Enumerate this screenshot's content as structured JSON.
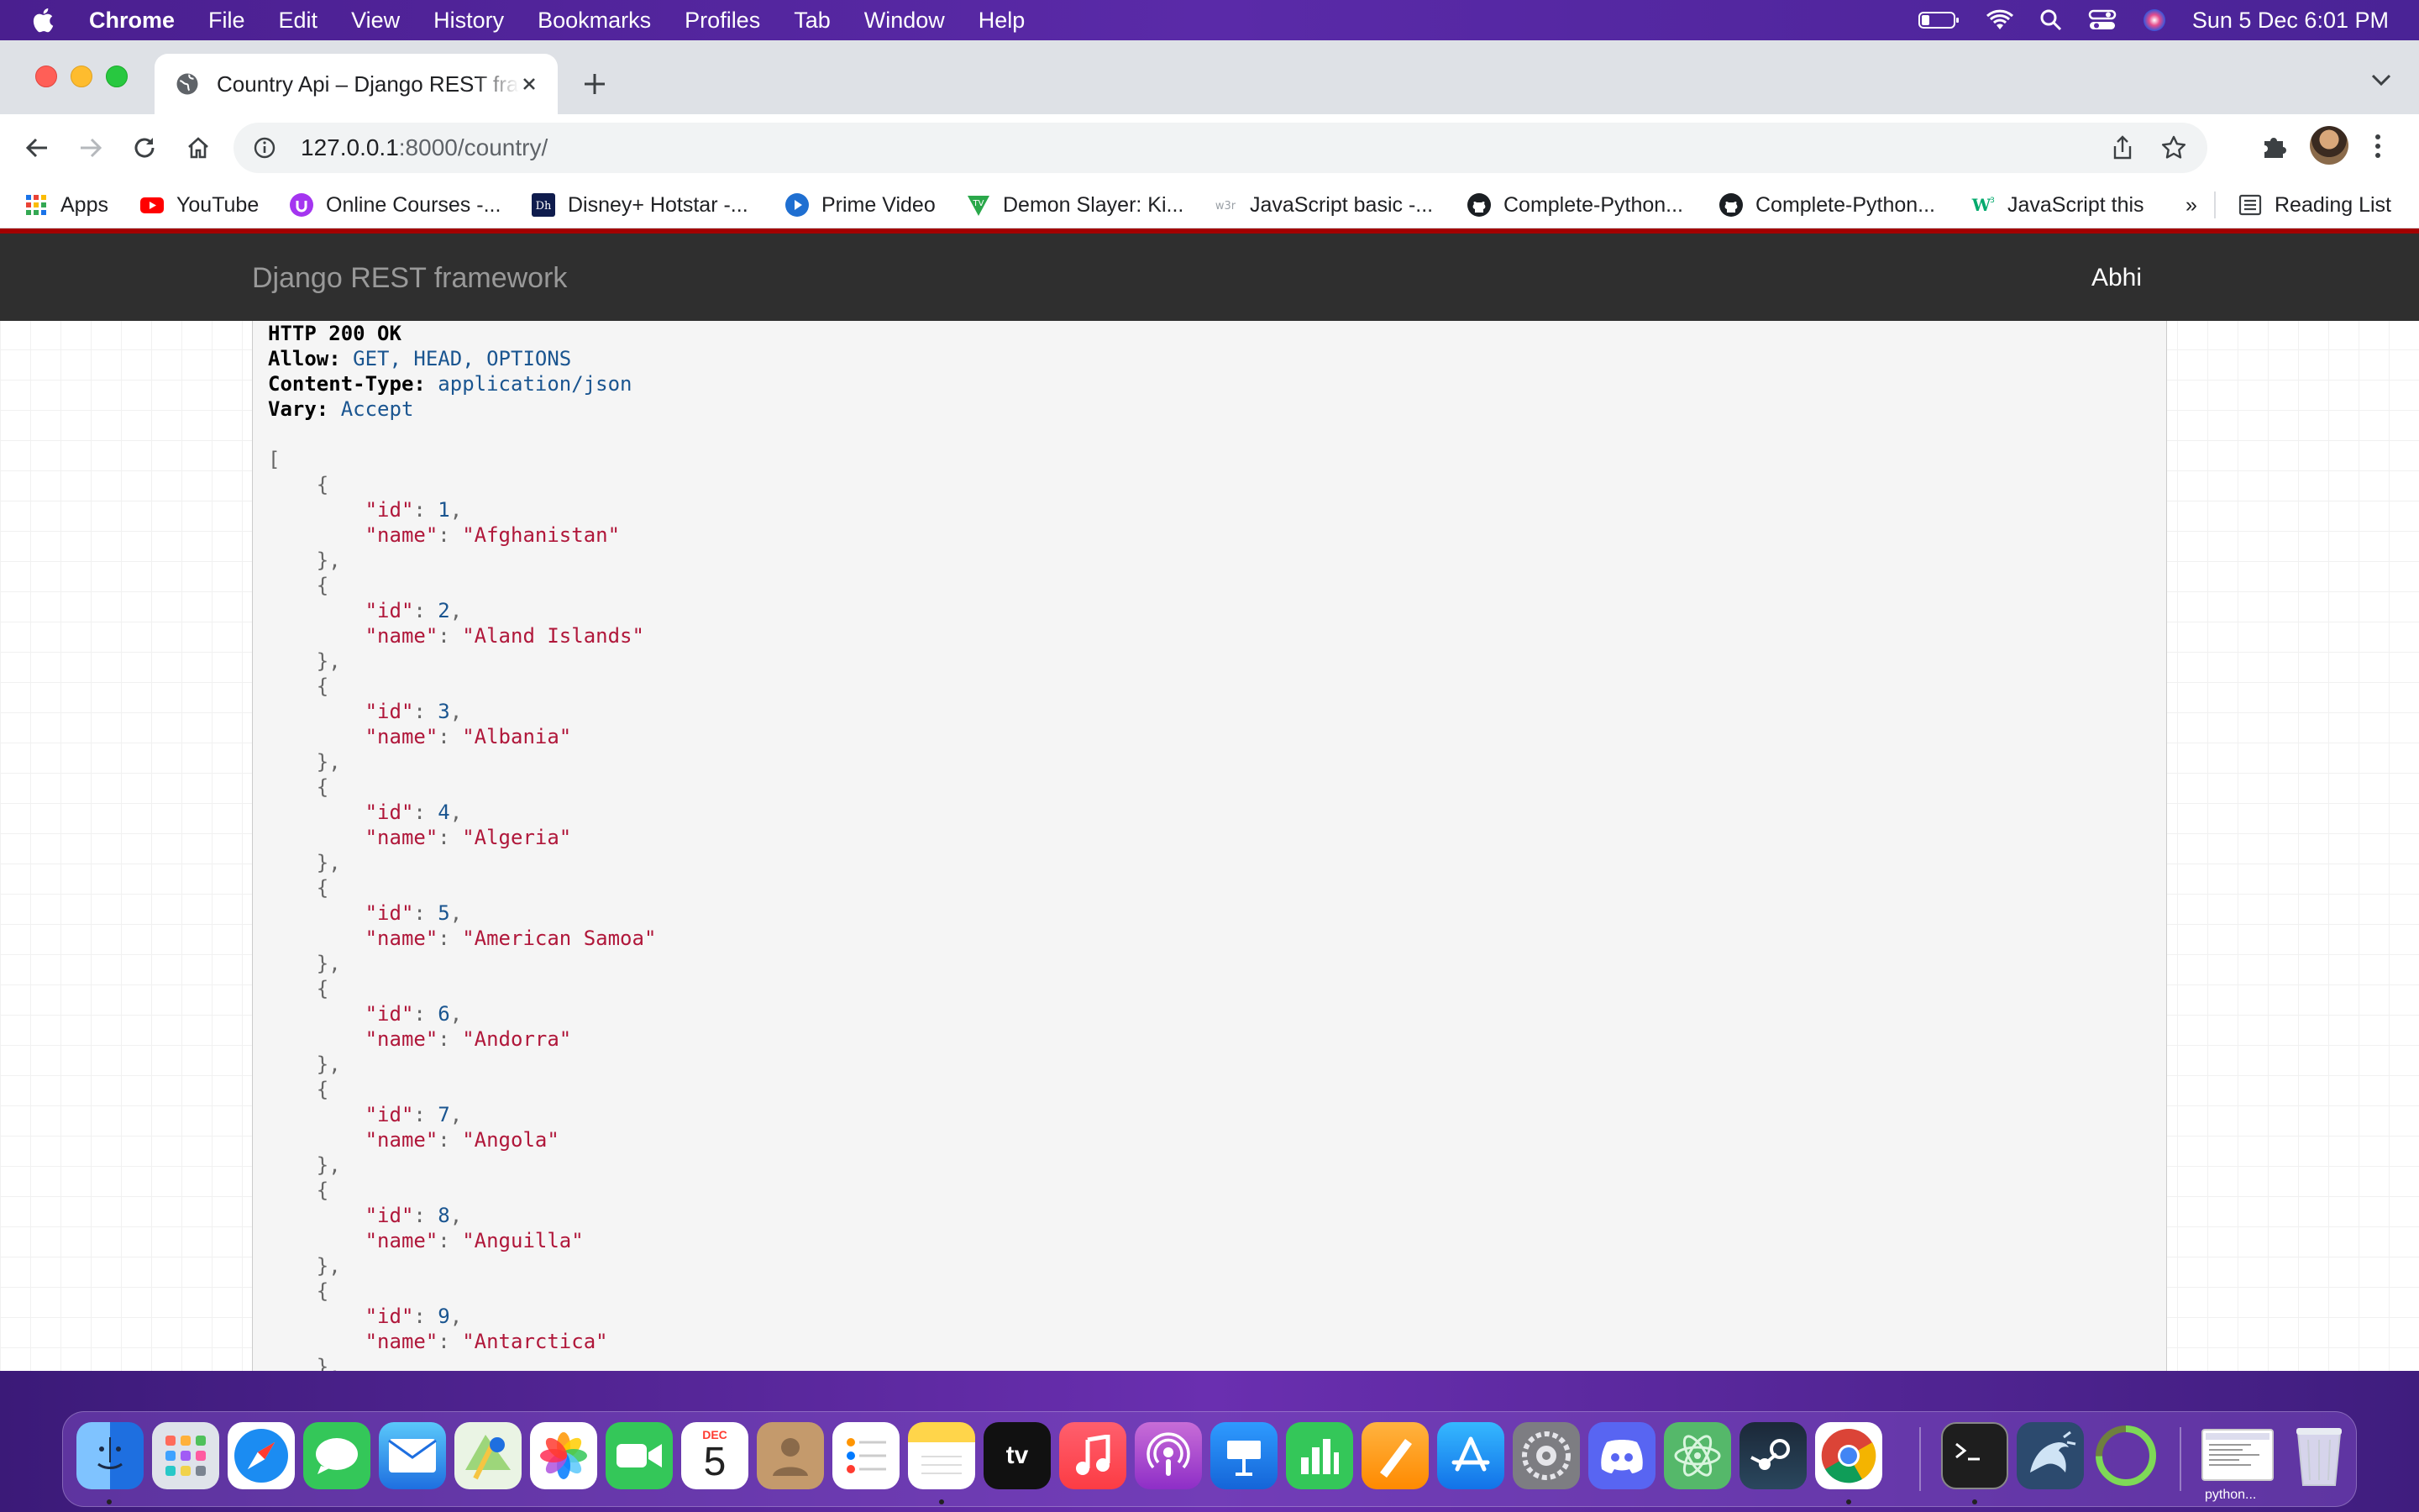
{
  "menubar": {
    "app_name": "Chrome",
    "menus": [
      "File",
      "Edit",
      "View",
      "History",
      "Bookmarks",
      "Profiles",
      "Tab",
      "Window",
      "Help"
    ],
    "datetime": "Sun 5 Dec  6:01 PM"
  },
  "browser": {
    "tab_title": "Country Api – Django REST framework",
    "url_host": "127.0.0.1",
    "url_rest": ":8000/country/",
    "bookmarks": [
      {
        "label": "Apps",
        "icon": "apps-grid-icon"
      },
      {
        "label": "YouTube",
        "icon": "youtube-icon"
      },
      {
        "label": "Online Courses -...",
        "icon": "udemy-icon"
      },
      {
        "label": "Disney+ Hotstar -...",
        "icon": "hotstar-icon"
      },
      {
        "label": "Prime Video",
        "icon": "prime-video-icon"
      },
      {
        "label": "Demon Slayer: Ki...",
        "icon": "demon-slayer-icon"
      },
      {
        "label": "JavaScript basic -...",
        "icon": "w3r-icon"
      },
      {
        "label": "Complete-Python...",
        "icon": "github-icon"
      },
      {
        "label": "Complete-Python...",
        "icon": "github-icon"
      },
      {
        "label": "JavaScript this",
        "icon": "w3schools-icon"
      }
    ],
    "bookmarks_overflow": "»",
    "reading_list": "Reading List"
  },
  "drf": {
    "brand": "Django REST framework",
    "user": "Abhi",
    "response": {
      "status": "HTTP 200 OK",
      "headers": [
        {
          "key": "Allow:",
          "value": "GET, HEAD, OPTIONS"
        },
        {
          "key": "Content-Type:",
          "value": "application/json"
        },
        {
          "key": "Vary:",
          "value": "Accept"
        }
      ],
      "items": [
        {
          "id": "1",
          "name": "\"Afghanistan\""
        },
        {
          "id": "2",
          "name": "\"Aland Islands\""
        },
        {
          "id": "3",
          "name": "\"Albania\""
        },
        {
          "id": "4",
          "name": "\"Algeria\""
        },
        {
          "id": "5",
          "name": "\"American Samoa\""
        },
        {
          "id": "6",
          "name": "\"Andorra\""
        },
        {
          "id": "7",
          "name": "\"Angola\""
        },
        {
          "id": "8",
          "name": "\"Anguilla\""
        },
        {
          "id": "9",
          "name": "\"Antarctica\""
        }
      ]
    }
  },
  "dock": {
    "calendar_month": "DEC",
    "calendar_day": "5",
    "appletv_label": "tv",
    "last_window_label": "python..."
  }
}
